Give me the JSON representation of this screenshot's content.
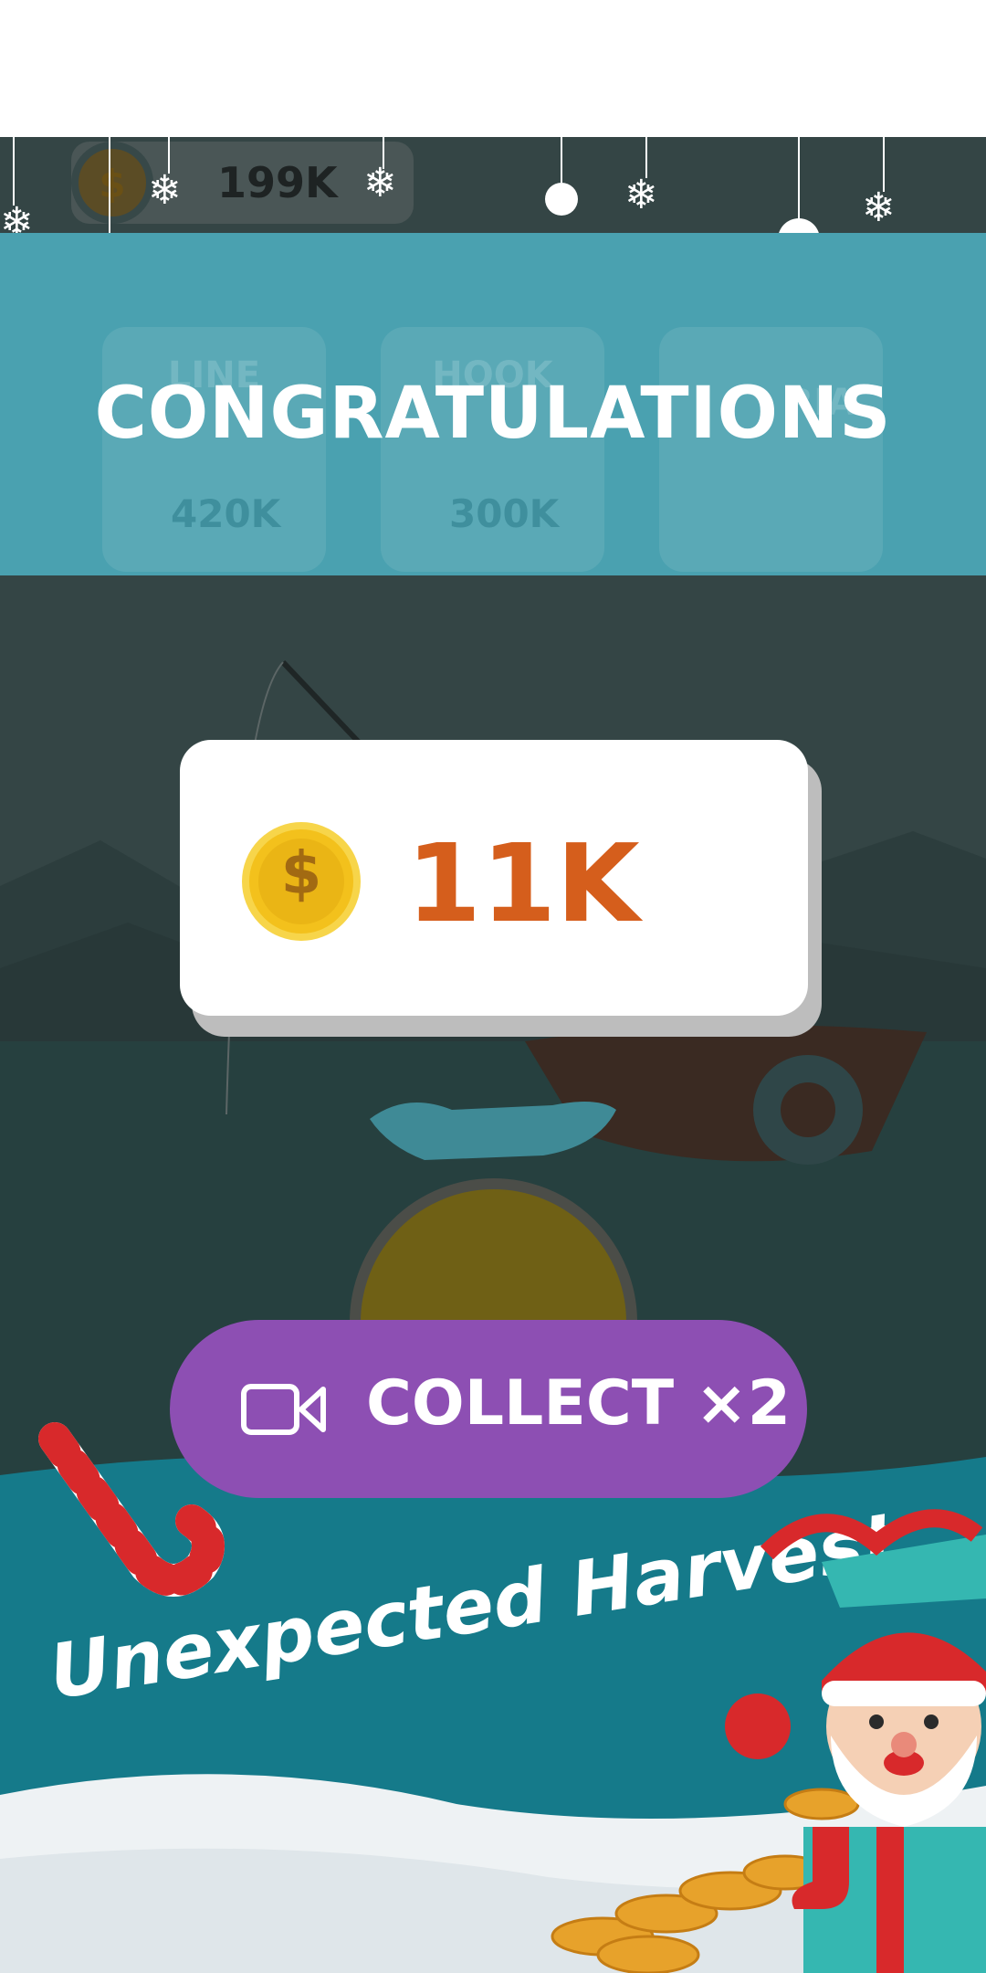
{
  "top_bar": {
    "coin_balance": "199K",
    "coin_icon": "dollar-coin-icon"
  },
  "upgrades": [
    {
      "title": "LINE",
      "price": "420K"
    },
    {
      "title": "HOOK",
      "price": "300K"
    },
    {
      "title": "RIA",
      "price": ""
    }
  ],
  "dialog": {
    "title": "CONGRATULATIONS",
    "reward_amount": "11K",
    "reward_icon": "gold-coin-icon",
    "collect_button_label": "COLLECT ×2",
    "collect_button_icon": "video-camera-icon"
  },
  "promo": {
    "text": "Unexpected Harvest"
  },
  "colors": {
    "banner": "#4aa1b0",
    "reward_text": "#d55e1c",
    "collect_button": "#8d4fb3",
    "sea": "#157a8a"
  }
}
